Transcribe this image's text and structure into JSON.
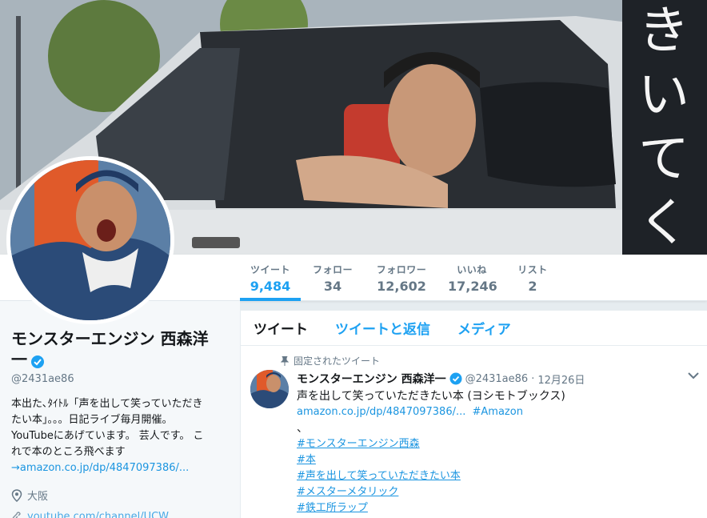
{
  "header": {
    "banner_text": "きいてく"
  },
  "nav": {
    "stats": [
      {
        "label": "ツイート",
        "value": "9,484",
        "active": true
      },
      {
        "label": "フォロー",
        "value": "34",
        "active": false
      },
      {
        "label": "フォロワー",
        "value": "12,602",
        "active": false
      },
      {
        "label": "いいね",
        "value": "17,246",
        "active": false
      },
      {
        "label": "リスト",
        "value": "2",
        "active": false
      }
    ]
  },
  "profile": {
    "name_line1": "モンスターエンジン 西森洋",
    "name_line2": "一",
    "handle": "@2431ae86",
    "bio_lines": [
      "本出た､ﾀｲﾄﾙ「声を出して笑っていただき",
      "たい本」。。。日記ライブ毎月開催。",
      "YouTubeにあげています。 芸人です。 こ",
      "れで本のところ飛べます"
    ],
    "bio_link": "→amazon.co.jp/dp/4847097386/...",
    "location": "大阪",
    "url_partial": "youtube.com/channel/UCW..."
  },
  "tabs": {
    "tweets": "ツイート",
    "tweets_replies": "ツイートと返信",
    "media": "メディア"
  },
  "tweet": {
    "pinned_label": "固定されたツイート",
    "name": "モンスターエンジン 西森洋一",
    "handle": "@2431ae86",
    "separator": "·",
    "date": "12月26日",
    "text": "声を出して笑っていただきたい本 (ヨシモトブックス)",
    "link": "amazon.co.jp/dp/4847097386/...",
    "link_tag": "#Amazon",
    "comma": "、",
    "hashtags": [
      "#モンスターエンジン西森",
      "#本",
      "#声を出して笑っていただきたい本",
      "#メスターメタリック",
      "#鉄工所ラップ"
    ]
  },
  "colors": {
    "accent": "#1da1f2",
    "link": "#1b95e0",
    "muted": "#657786"
  }
}
